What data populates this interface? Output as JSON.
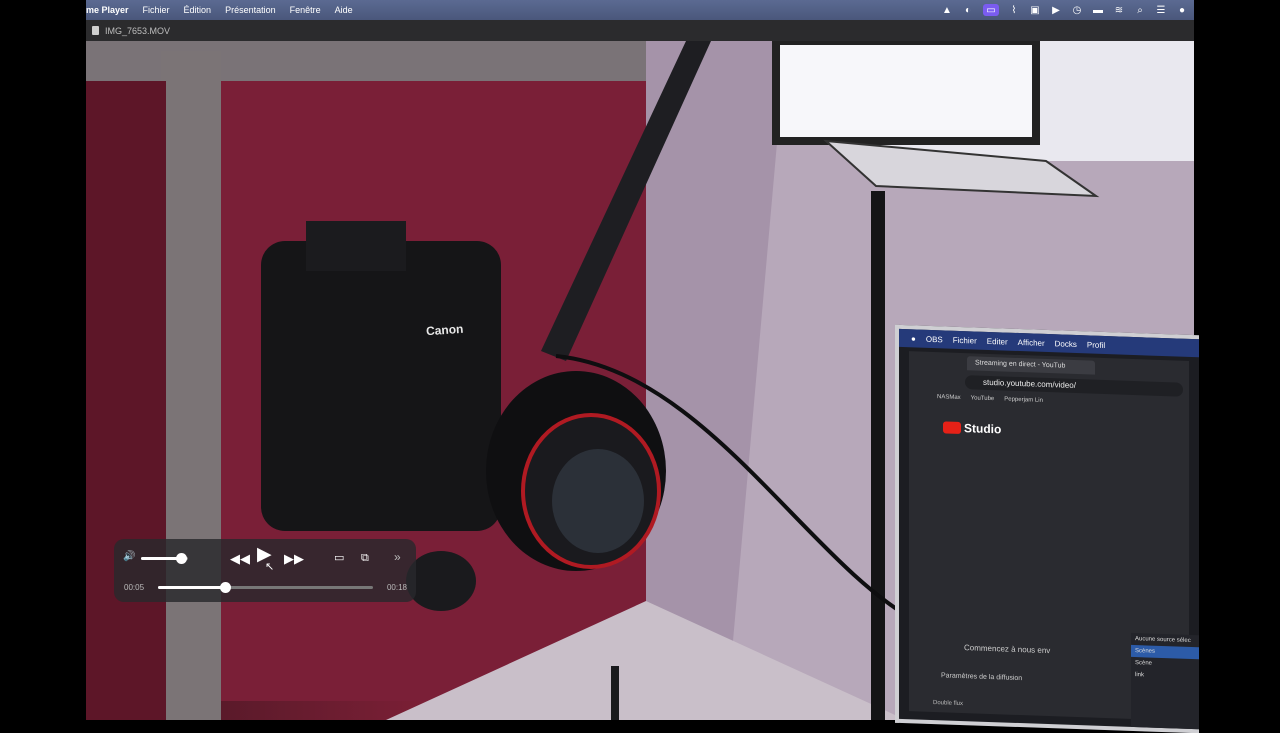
{
  "menubar": {
    "app_name": "me Player",
    "items": [
      "Fichier",
      "Édition",
      "Présentation",
      "Fenêtre",
      "Aide"
    ]
  },
  "window": {
    "title": "IMG_7653.MOV"
  },
  "hud": {
    "volume_level": 0.85,
    "playhead_level": 0.31,
    "current_time": "00:05",
    "total_time": "00:18"
  },
  "monitor": {
    "menubar": [
      "OBS",
      "Fichier",
      "Editer",
      "Afficher",
      "Docks",
      "Profil"
    ],
    "tab_title": "Streaming en direct - YouTub",
    "url": "studio.youtube.com/video/",
    "bookmarks": [
      "NASMax",
      "YouTube",
      "Pepperjam Lin"
    ],
    "logo_text": "Studio",
    "start_text": "Commencez à nous env",
    "params_text": "Paramètres de la diffusion",
    "double_text": "Double flux",
    "obs_no_source": "Aucune source sélec",
    "obs_scenes_header": "Scènes",
    "obs_scene_1": "Scène",
    "obs_scene_2": "link"
  },
  "camera": {
    "brand": "Canon"
  },
  "colors": {
    "menubar": "#4f5c82",
    "hud_bg": "#28282c",
    "active_status_icon": "#7a5cf0"
  }
}
